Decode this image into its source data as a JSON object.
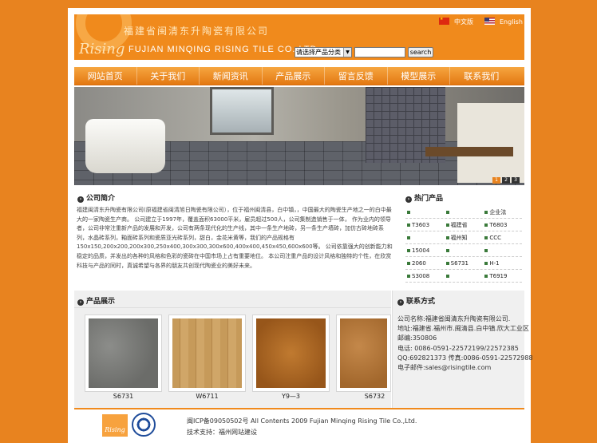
{
  "header": {
    "brand_cn": "福建省闽清东升陶瓷有限公司",
    "logo_text": "Rising",
    "brand_en": "FUJIAN MINQING RISING TILE CO.,LTD",
    "lang_cn": "中文版",
    "lang_en": "English"
  },
  "search": {
    "select_value": "请选择产品分类",
    "button_label": "search"
  },
  "nav": {
    "items": [
      "网站首页",
      "关于我们",
      "新闻资讯",
      "产品展示",
      "留言反馈",
      "模型展示",
      "联系我们"
    ]
  },
  "banner": {
    "pager": [
      "1",
      "2",
      "3"
    ]
  },
  "about": {
    "title": "公司简介",
    "text": "福建闽清东升陶瓷有限公司(原福建省闽清旭日陶瓷有限公司），位于福州闽清县，白中镇，，中国最大的陶瓷生产地之一的白中最大的一家陶瓷生产商。 公司建立于1997年，覆盖面积63000平米，雇员超过500人，公司集制造销售于一体， 作为业内的领导者，公司非常注重新产品的发展和开发，公司有两条现代化的生产线，其中一条生产地砖，另一条生产墙砖，加仿古砖地砖系列，水晶砖系列，釉面砖系列和瓷质亚光砖系列，甜白，金花米黄等，我们的产品规格有150x150,200x200,200x300,250x400,300x300,300x600,400x400,450x450,600x600等。 公司依靠强大的创新能力和稳定的品质，并发出的各种的风格和色彩的瓷砖在中国市场上占有重要地位。 本公司注重产品的设计风格和独特的个性，在欣赏科技与产品的同时，真诚希望与各界的朋友共创现代陶瓷业的美好未来。"
  },
  "hot": {
    "title": "热门产品",
    "rows": [
      [
        "",
        "",
        "企业法"
      ],
      [
        "T3603",
        "福建省",
        "T6803"
      ],
      [
        "",
        "福州知",
        "CCC"
      ],
      [
        "15004",
        "",
        ""
      ],
      [
        "2060",
        "S6731",
        "H-1"
      ],
      [
        "S3008",
        "",
        "T6919"
      ]
    ]
  },
  "products": {
    "title": "产品展示",
    "items": [
      {
        "label": "S6731",
        "color": "#7a7b78"
      },
      {
        "label": "W6711",
        "color": "#c79a5c"
      },
      {
        "label": "Y9—3",
        "color": "#b06a22"
      },
      {
        "label": "S6732",
        "color": "#b5793a"
      }
    ]
  },
  "contact": {
    "title": "联系方式",
    "lines": [
      "公司名称:福建省闽清东升陶瓷有限公司.",
      "地址:福建省.福州市.闽清县.白中镇.欣大工业区",
      "邮编:350806",
      "电话: 0086-0591-22572199/22572385",
      "QQ:692821373 传真:0086-0591-22572988",
      "电子邮件:sales@risingtile.com"
    ]
  },
  "footer": {
    "copyright": "闽ICP备09050502号 All Contents 2009 Fujian Minqing Rising Tile Co.,Ltd.",
    "support": "技术支持：福州网站建设",
    "logo_text": "Rising"
  }
}
